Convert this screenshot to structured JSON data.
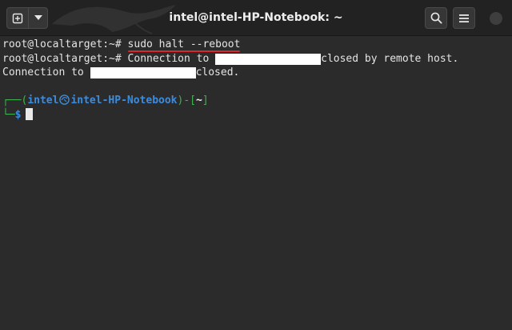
{
  "window": {
    "title": "intel@intel-HP-Notebook: ~"
  },
  "toolbar": {
    "new_tab_icon": "new-tab-icon",
    "dropdown_icon": "chevron-down-icon",
    "search_icon": "search-icon",
    "menu_icon": "hamburger-menu-icon"
  },
  "terminal": {
    "line1": {
      "prompt": "root@localtarget:~# ",
      "command": "sudo halt --reboot"
    },
    "line2": {
      "prompt": "root@localtarget:~# ",
      "text_before": "Connection to ",
      "text_after": "closed by remote host."
    },
    "line3": {
      "text_before": "Connection to ",
      "text_after": "closed."
    },
    "prompt": {
      "corner_top": "┌──(",
      "user": "intel",
      "host": "intel-HP-Notebook",
      "mid": ")-[",
      "dir": "~",
      "close": "]",
      "corner_bottom": "└─",
      "symbol": "$"
    }
  },
  "colors": {
    "background": "#2b2b2b",
    "titlebar": "#222222",
    "command_underline": "#d8262e",
    "prompt_green": "#3fb34f",
    "prompt_blue": "#3c8cde"
  }
}
